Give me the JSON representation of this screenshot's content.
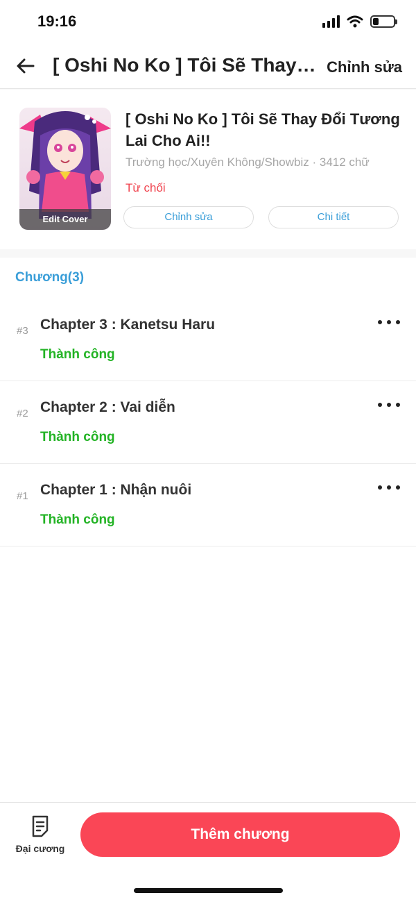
{
  "status_bar": {
    "time": "19:16",
    "battery_level": 0.3
  },
  "nav": {
    "title": "[ Oshi No Ko ] Tôi Sẽ Thay Đổi Tương Lai Cho Ai!!",
    "action": "Chỉnh sửa"
  },
  "book": {
    "title": "[ Oshi No Ko ] Tôi Sẽ Thay Đổi Tương Lai Cho Ai!!",
    "meta": "Trường học/Xuyên Không/Showbiz · 3412 chữ",
    "status": "Từ chối",
    "cover_label": "Edit Cover",
    "edit_button": "Chỉnh sửa",
    "detail_button": "Chi tiết"
  },
  "chapters_section": {
    "heading": "Chương(3)",
    "items": [
      {
        "num": "#3",
        "title": "Chapter 3 : Kanetsu Haru",
        "status": "Thành công"
      },
      {
        "num": "#2",
        "title": "Chapter 2 : Vai diễn",
        "status": "Thành công"
      },
      {
        "num": "#1",
        "title": "Chapter 1 : Nhận nuôi",
        "status": "Thành công"
      }
    ]
  },
  "bottom": {
    "outline_label": "Đại cương",
    "add_button": "Thêm chương"
  },
  "colors": {
    "accent_blue": "#3a9ed8",
    "reject_red": "#f0444f",
    "success_green": "#22b324",
    "primary_button": "#fa4656"
  },
  "icons": {
    "back": "arrow-left-icon",
    "more": "more-horizontal-icon",
    "outline": "document-icon",
    "wifi": "wifi-icon",
    "signal": "signal-icon",
    "battery": "battery-icon"
  }
}
